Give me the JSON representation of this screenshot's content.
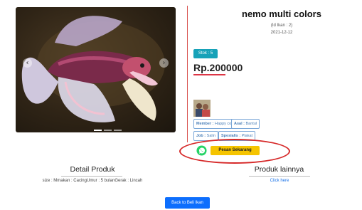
{
  "product": {
    "title": "nemo multi colors",
    "id_line": "(Id Ikan : 2)",
    "date": "2021-12-12",
    "stock": "Stok : 5",
    "price": "Rp.200000"
  },
  "seller": {
    "member_label": "Member :",
    "member_value": "Happy coy",
    "asal_label": "Asal :",
    "asal_value": "Bantul",
    "job_label": "Job :",
    "job_value": "Salin",
    "special_label": "Spesialis :",
    "special_value": "Plakat"
  },
  "order": {
    "button_label": "Pesan Sekarang"
  },
  "detail": {
    "heading": "Detail Produk",
    "text": "size : Mmakan : CacingUmur : 5 bulanGerak : Lincah"
  },
  "others": {
    "heading": "Produk lainnya",
    "link": "Click here"
  },
  "footer": {
    "back_button": "Back to Beli Ikan"
  },
  "carousel": {
    "prev_icon": "chevron-left-icon",
    "next_icon": "chevron-right-icon",
    "indicator_count": 3,
    "active_indicator": 1
  },
  "colors": {
    "accent_red": "#dc3545",
    "stock_badge": "#17a2b8",
    "order_button": "#f5c400",
    "back_button": "#0d6efd",
    "tag_border": "#7aa7d8",
    "whatsapp": "#25d366"
  }
}
